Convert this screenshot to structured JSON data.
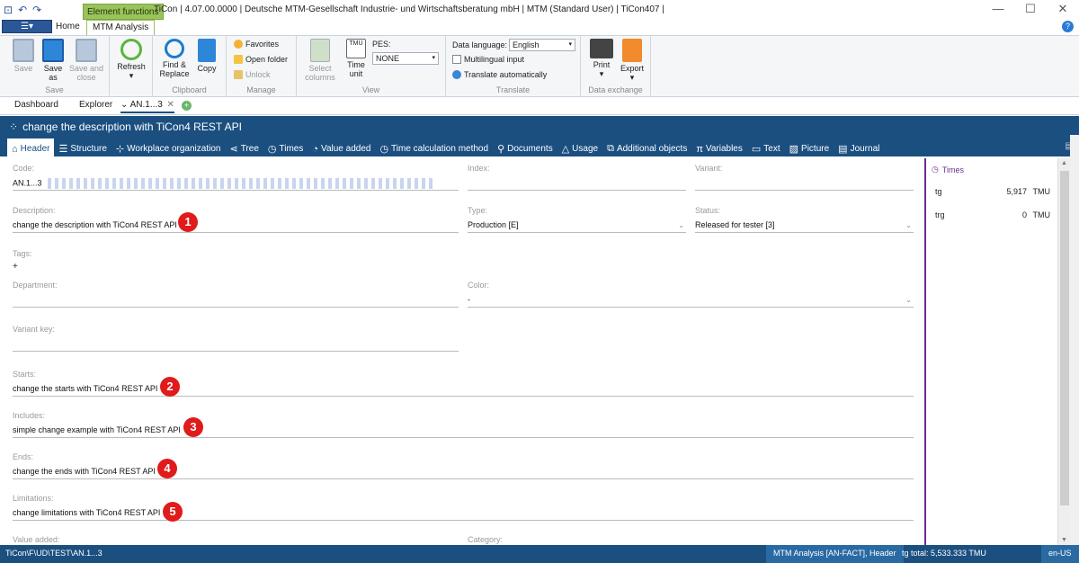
{
  "window": {
    "title": "TiCon | 4.07.00.0000 | Deutsche MTM-Gesellschaft Industrie- und Wirtschaftsberatung mbH | MTM (Standard User) | TiCon407 |",
    "context_tab": "Element functions",
    "minimize": "—",
    "maximize": "☐",
    "close": "✕"
  },
  "ribbon_tabs": {
    "home": "Home",
    "mtm": "MTM Analysis"
  },
  "ribbon": {
    "save_group": {
      "label": "Save",
      "save": "Save",
      "save_as": "Save as",
      "save_close": "Save and close"
    },
    "refresh_group": {
      "refresh": "Refresh"
    },
    "clipboard_group": {
      "label": "Clipboard",
      "find": "Find & Replace",
      "copy": "Copy"
    },
    "manage_group": {
      "label": "Manage",
      "favorites": "Favorites",
      "open_folder": "Open folder",
      "unlock": "Unlock"
    },
    "view_group": {
      "label": "View",
      "select_columns": "Select columns",
      "time_unit": "Time unit",
      "pes_label": "PES:",
      "pes_value": "NONE",
      "tmu_icon_text": "TMU"
    },
    "translate_group": {
      "label": "Translate",
      "data_language_label": "Data language:",
      "data_language": "English",
      "multilingual": "Multilingual input",
      "translate_auto": "Translate automatically"
    },
    "exchange_group": {
      "label": "Data exchange",
      "print": "Print",
      "export": "Export"
    }
  },
  "doc_tabs": {
    "dashboard": "Dashboard",
    "explorer": "Explorer",
    "active": "AN.1...3"
  },
  "header": {
    "title": "change the description with TiCon4 REST API",
    "tabs": [
      {
        "label": "Header",
        "icon": "home-icon"
      },
      {
        "label": "Structure",
        "icon": "structure-icon"
      },
      {
        "label": "Workplace organization",
        "icon": "workplace-icon"
      },
      {
        "label": "Tree",
        "icon": "tree-icon"
      },
      {
        "label": "Times",
        "icon": "clock-icon"
      },
      {
        "label": "Value added",
        "icon": "pie-icon"
      },
      {
        "label": "Time calculation method",
        "icon": "clock-icon"
      },
      {
        "label": "Documents",
        "icon": "paperclip-icon"
      },
      {
        "label": "Usage",
        "icon": "usage-icon"
      },
      {
        "label": "Additional objects",
        "icon": "objects-icon"
      },
      {
        "label": "Variables",
        "icon": "pi-icon"
      },
      {
        "label": "Text",
        "icon": "text-icon"
      },
      {
        "label": "Picture",
        "icon": "picture-icon"
      },
      {
        "label": "Journal",
        "icon": "journal-icon"
      }
    ]
  },
  "form": {
    "code": {
      "label": "Code:",
      "value": "AN.1...3"
    },
    "index": {
      "label": "Index:",
      "value": ""
    },
    "variant": {
      "label": "Variant:",
      "value": ""
    },
    "description": {
      "label": "Description:",
      "value": "change the description with TiCon4 REST API",
      "badge": "1"
    },
    "type": {
      "label": "Type:",
      "value": "Production [E]"
    },
    "status": {
      "label": "Status:",
      "value": "Released for tester [3]"
    },
    "tags": {
      "label": "Tags:",
      "value": "+"
    },
    "department": {
      "label": "Department:",
      "value": ""
    },
    "color": {
      "label": "Color:",
      "value": "-"
    },
    "variant_key": {
      "label": "Variant key:",
      "value": ""
    },
    "starts": {
      "label": "Starts:",
      "value": "change the starts with TiCon4 REST API",
      "badge": "2"
    },
    "includes": {
      "label": "Includes:",
      "value": "simple change example with TiCon4 REST API",
      "badge": "3"
    },
    "ends": {
      "label": "Ends:",
      "value": "change the ends with TiCon4 REST API",
      "badge": "4"
    },
    "limitations": {
      "label": "Limitations:",
      "value": "change limitations with TiCon4 REST API",
      "badge": "5"
    },
    "value_added": {
      "label": "Value added:"
    },
    "category": {
      "label": "Category:"
    }
  },
  "times_panel": {
    "title": "Times",
    "rows": [
      {
        "name": "tg",
        "value": "5,917",
        "unit": "TMU"
      },
      {
        "name": "trg",
        "value": "0",
        "unit": "TMU"
      }
    ]
  },
  "status_bar": {
    "path": "TiCon\\F\\UD\\TEST\\AN.1...3",
    "mode": "MTM Analysis [AN-FACT], Header",
    "total": "tg total: 5,533.333 TMU",
    "locale": "en-US"
  }
}
